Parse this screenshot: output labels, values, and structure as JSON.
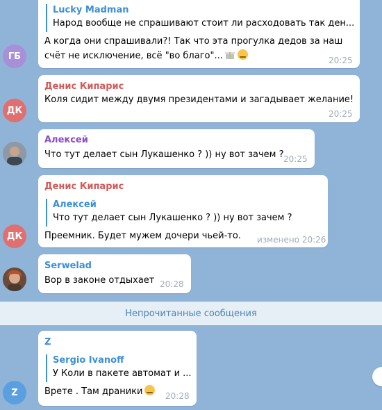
{
  "colors": {
    "background": "#90b3d8",
    "bubble": "#ffffff",
    "reply_accent": "#3a8fd6",
    "time": "#a0acb6",
    "sender_denis": "#d15a5a",
    "sender_aleksey": "#8a4bc8",
    "sender_serwelad": "#3a8fd6",
    "sender_z": "#3a8fd6"
  },
  "messages": [
    {
      "avatar": "ГБ",
      "reply_name": "Lucky Madman",
      "reply_text": "Народ вообще не спрашивают стоит ли расходовать так ден...",
      "line1": "А когда они спрашивали?! Так что эта прогулка дедов за наш",
      "line2": "счёт не исключение, всё \"во благо\"...",
      "time": "20:25"
    },
    {
      "avatar": "ДК",
      "sender": "Денис Кипарис",
      "text": "Коля сидит между двумя президентами и загадывает желание!",
      "time": "20:25"
    },
    {
      "sender": "Алексей",
      "text": "Что тут делает сын Лукашенко ? )) ну вот зачем ?",
      "time": "20:25"
    },
    {
      "avatar": "ДК",
      "sender": "Денис Кипарис",
      "reply_name": "Алексей",
      "reply_text": "Что тут делает сын Лукашенко ? )) ну вот зачем ?",
      "text": "Преемник. Будет мужем дочери чьей-то.",
      "time": "изменено 20:26"
    },
    {
      "sender": "Serwelad",
      "text": "Вор в законе отдыхает",
      "time": "20:28"
    },
    {
      "avatar": "Z",
      "sender": "Z",
      "reply_name": "Sergio Ivanoff",
      "reply_text": "У Коли в пакете автомат и ...",
      "text": "Врете . Там драники",
      "time": "20:28"
    }
  ],
  "divider": "Непрочитанные сообщения"
}
